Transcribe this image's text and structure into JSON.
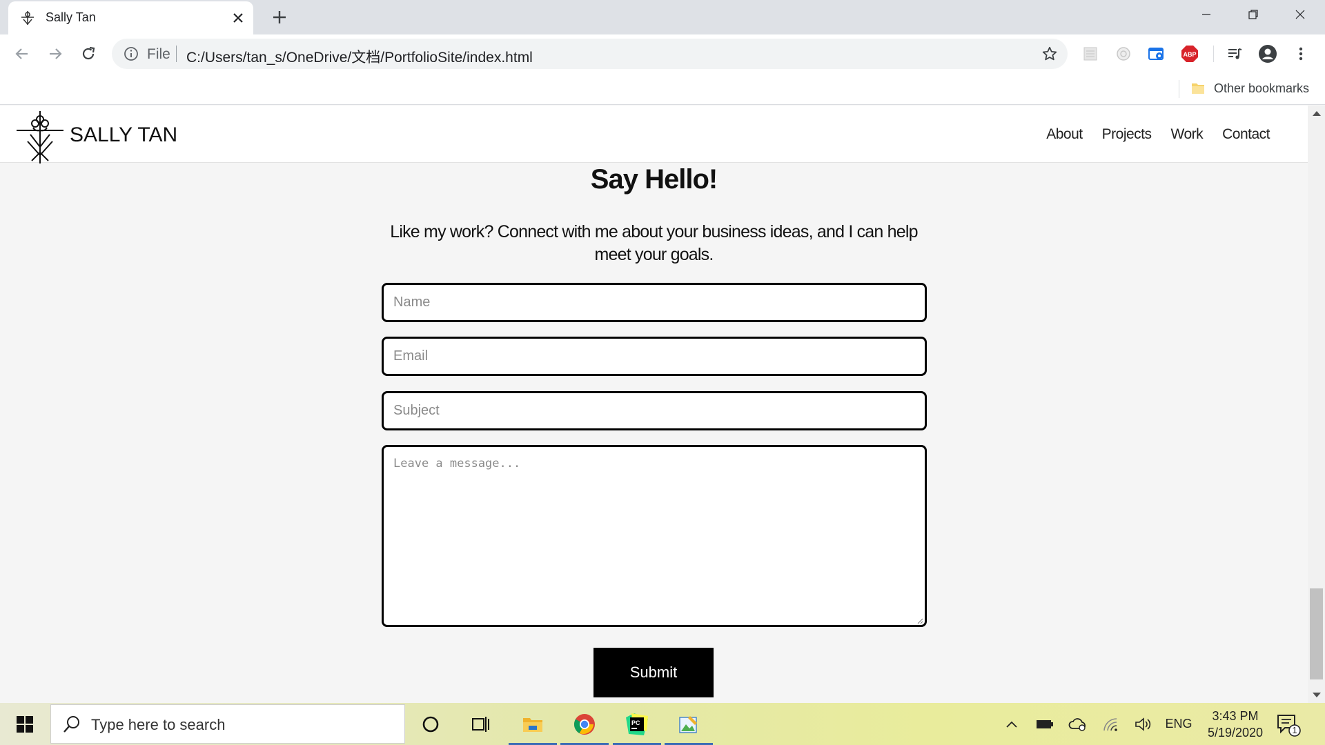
{
  "browser": {
    "tab_title": "Sally Tan",
    "omnibox_scheme": "File",
    "url": "C:/Users/tan_s/OneDrive/文档/PortfolioSite/index.html",
    "bookmarks_label": "Other bookmarks",
    "extensions": [
      "extension-grid-icon",
      "extension-circle-icon",
      "screenshot-extension-icon",
      "adblock-plus-icon",
      "media-control-icon",
      "profile-icon",
      "menu-icon"
    ]
  },
  "site": {
    "brand": "SALLY TAN",
    "nav": [
      "About",
      "Projects",
      "Work",
      "Contact"
    ],
    "contact": {
      "heading": "Say Hello!",
      "intro": "Like my work? Connect with me about your business ideas, and I can help meet your goals.",
      "name_placeholder": "Name",
      "email_placeholder": "Email",
      "subject_placeholder": "Subject",
      "message_placeholder": "Leave a message...",
      "submit_label": "Submit"
    }
  },
  "taskbar": {
    "search_placeholder": "Type here to search",
    "language": "ENG",
    "time": "3:43 PM",
    "date": "5/19/2020",
    "notification_count": "1"
  },
  "colors": {
    "tabstrip": "#dee1e6",
    "page_bg": "#f5f5f5",
    "submit_bg": "#000000",
    "taskbar_accent": "#3c6db5"
  }
}
